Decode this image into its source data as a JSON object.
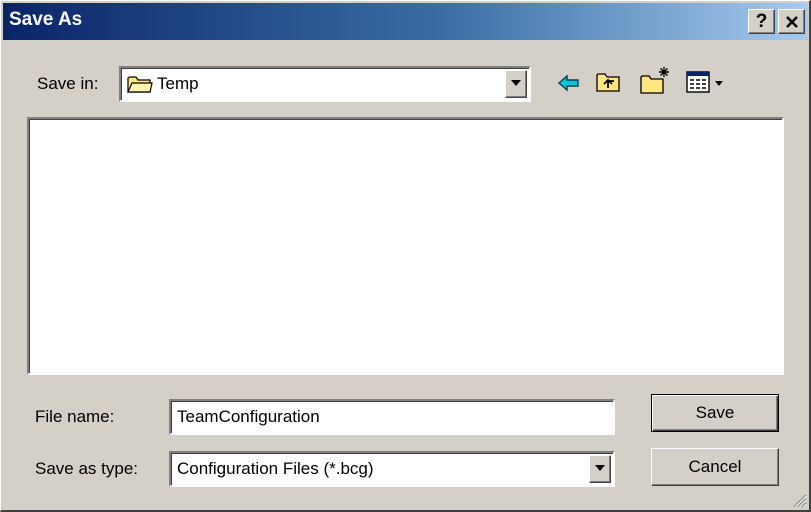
{
  "window": {
    "title": "Save As",
    "help_glyph": "?",
    "close_glyph": "✕"
  },
  "toolbar": {
    "save_in_label": "Save in:",
    "save_in_value": "Temp",
    "icons": [
      "back-arrow-icon",
      "up-folder-icon",
      "new-folder-icon",
      "view-menu-icon"
    ]
  },
  "file_list": {
    "items": []
  },
  "form": {
    "file_name_label": "File name:",
    "file_name_value": "TeamConfiguration",
    "save_as_type_label": "Save as type:",
    "save_as_type_value": "Configuration Files (*.bcg)"
  },
  "buttons": {
    "save_label": "Save",
    "cancel_label": "Cancel"
  },
  "colors": {
    "title_gradient_start": "#0a246a",
    "title_gradient_end": "#a6caf0",
    "face": "#d4d0c8",
    "folder_yellow": "#ffe680"
  }
}
